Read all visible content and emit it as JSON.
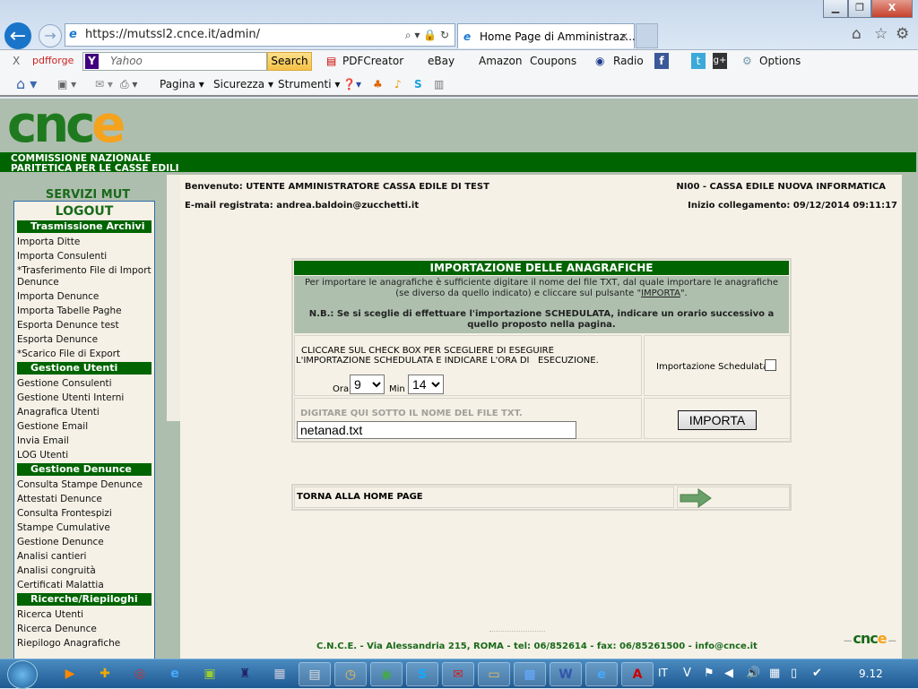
{
  "browser": {
    "url": "https://mutssl2.cnce.it/admin/",
    "tab_title": "Home Page di Amministraz...",
    "window_buttons": {
      "minimize": "▁",
      "restore": "❐",
      "close": "X"
    },
    "toolbar1": {
      "close": "X",
      "pdfforge": "pdfforge",
      "search_placeholder": "Yahoo",
      "search_button": "Search",
      "pdfcreator": "PDFCreator",
      "ebay": "eBay",
      "amazon": "Amazon",
      "coupons": "Coupons",
      "radio": "Radio",
      "options": "Options"
    },
    "toolbar2": {
      "pagina": "Pagina",
      "sicurezza": "Sicurezza",
      "strumenti": "Strumenti"
    }
  },
  "site": {
    "logo": "CNCE",
    "org_line1": "COMMISSIONE NAZIONALE",
    "org_line2": "PARITETICA PER LE CASSE EDILI",
    "servizi": "SERVIZI MUT",
    "logout": "LOGOUT"
  },
  "sidebar": {
    "sections": [
      {
        "title": "Trasmissione Archivi",
        "items": [
          "Importa Ditte",
          "Importa Consulenti",
          "*Trasferimento File di Import Denunce",
          "Importa Denunce",
          "Importa Tabelle Paghe",
          "Esporta Denunce test",
          "Esporta Denunce",
          "*Scarico File di Export"
        ]
      },
      {
        "title": "Gestione Utenti",
        "items": [
          "Gestione Consulenti",
          "Gestione Utenti Interni",
          "Anagrafica Utenti",
          "Gestione Email",
          "Invia Email",
          "LOG Utenti"
        ]
      },
      {
        "title": "Gestione Denunce",
        "items": [
          "Consulta Stampe Denunce",
          "Attestati Denunce",
          "Consulta Frontespizi",
          "Stampe Cumulative",
          "Gestione Denunce",
          "Analisi cantieri",
          "Analisi congruità",
          "Certificati Malattia"
        ]
      },
      {
        "title": "Ricerche/Riepiloghi",
        "items": [
          "Ricerca Utenti",
          "Ricerca Denunce",
          "Riepilogo Anagrafiche"
        ]
      }
    ]
  },
  "header": {
    "welcome": "Benvenuto: UTENTE AMMINISTRATORE CASSA EDILE DI TEST",
    "cassa": "NI00 - CASSA EDILE NUOVA INFORMATICA",
    "email": "E-mail registrata: andrea.baldoin@zucchetti.it",
    "login": "Inizio collegamento: 09/12/2014 09:11:17"
  },
  "panel": {
    "title": "IMPORTAZIONE DELLE ANAGRAFICHE",
    "desc1": "Per importare le anagrafiche è sufficiente digitare il nome del file TXT, dal quale importare le anagrafiche (se diverso da quello indicato) e cliccare sul pulsante \"",
    "desc_link": "IMPORTA",
    "desc2": "\".",
    "nb": "N.B.: Se si sceglie di effettuare l'importazione SCHEDULATA, indicare un orario successivo a quello proposto nella pagina.",
    "schedule_text": "CLICCARE SUL CHECK BOX PER SCEGLIERE DI ESEGUIRE   L'IMPORTAZIONE SCHEDULATA E INDICARE L'ORA DI   ESECUZIONE.",
    "ora_label": "Ora",
    "ora_value": "9",
    "min_label": "Min",
    "min_value": "14",
    "checkbox_label": "Importazione Schedulata",
    "checkbox_checked": false,
    "file_label": "DIGITARE QUI SOTTO IL NOME DEL FILE TXT.",
    "file_value": "netanad.txt",
    "import_button": "IMPORTA",
    "home_link": "TORNA ALLA HOME PAGE"
  },
  "footer": {
    "text": "C.N.C.E. - Via Alessandria 215, ROMA - tel: 06/852614 - fax: 06/85261500 - info@cnce.it",
    "logo": "cnce"
  },
  "taskbar": {
    "language": "IT",
    "clock": "9.12"
  },
  "colors": {
    "green": "#006400",
    "sidebar_bg": "#aebeae",
    "content_bg": "#f5f1e6",
    "logo_orange": "#f5a21c"
  }
}
